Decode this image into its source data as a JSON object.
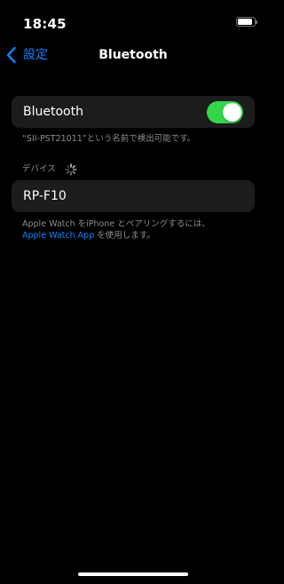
{
  "status_bar": {
    "time": "18:45",
    "battery_level": 0.9
  },
  "nav": {
    "back_label": "設定",
    "title": "Bluetooth"
  },
  "bluetooth_cell": {
    "label": "Bluetooth",
    "toggle_on": true,
    "toggle_color": "#32d74b"
  },
  "discoverable_note": "“SII-PST21011”という名前で検出可能です。",
  "devices_section": {
    "header": "デバイス",
    "items": [
      {
        "name": "RP-F10"
      }
    ]
  },
  "apple_watch_note": {
    "prefix": "Apple Watch をiPhone とペアリングするには、",
    "link": "Apple Watch App",
    "suffix": " を使用します。"
  },
  "colors": {
    "accent": "#0a84ff",
    "background": "#000000",
    "cell_background": "#1c1c1e",
    "secondary_text": "#8d8d93"
  }
}
